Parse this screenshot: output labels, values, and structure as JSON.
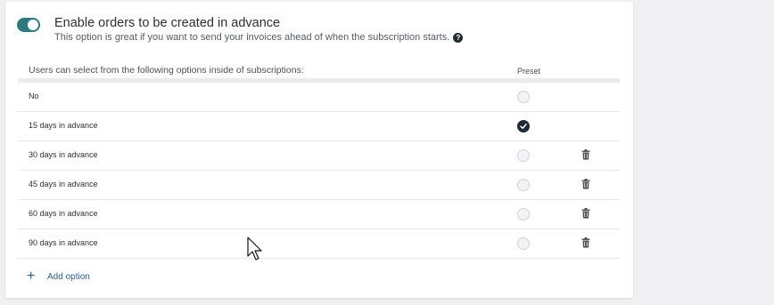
{
  "toggle": {
    "enabled": true
  },
  "header": {
    "title": "Enable orders to be created in advance",
    "subtitle": "This option is great if you want to send your invoices ahead of when the subscription starts.",
    "help_icon": "question-circle-icon"
  },
  "table": {
    "column_label": "Users can select from the following options inside of subscriptions:",
    "column_preset": "Preset",
    "rows": [
      {
        "label": "No",
        "preset": false,
        "deletable": false
      },
      {
        "label": "15 days in advance",
        "preset": true,
        "deletable": false
      },
      {
        "label": "30 days in advance",
        "preset": false,
        "deletable": true
      },
      {
        "label": "45 days in advance",
        "preset": false,
        "deletable": true
      },
      {
        "label": "60 days in advance",
        "preset": false,
        "deletable": true
      },
      {
        "label": "90 days in advance",
        "preset": false,
        "deletable": true
      }
    ]
  },
  "add_option": {
    "label": "Add option",
    "icon": "plus-icon"
  },
  "colors": {
    "accent": "#2c7a80",
    "link": "#2c5d8a",
    "dark": "#1f2a36"
  }
}
